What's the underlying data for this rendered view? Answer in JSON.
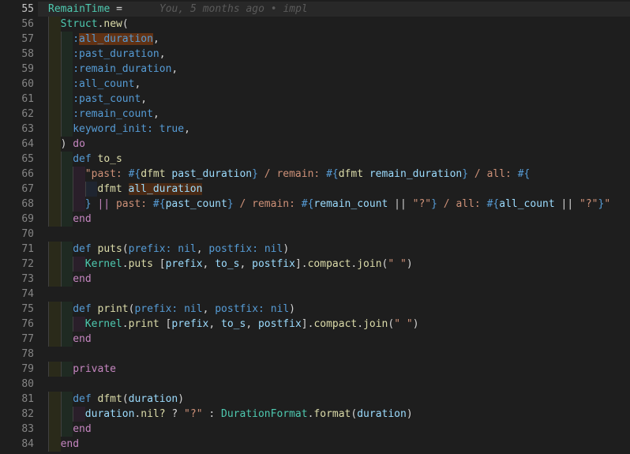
{
  "editor": {
    "blame": "You, 5 months ago • impl",
    "lines": [
      {
        "num": "55",
        "current": true,
        "tokens": [
          [
            "RemainTime",
            "const"
          ],
          [
            " = ",
            "punc"
          ]
        ]
      },
      {
        "num": "56",
        "tokens": [
          [
            "Struct",
            "const"
          ],
          [
            ".",
            "punc"
          ],
          [
            "new",
            "fn"
          ],
          [
            "(",
            "punc"
          ]
        ]
      },
      {
        "num": "57",
        "tokens": [
          [
            ":",
            "sym"
          ],
          [
            "all_duration",
            "sym",
            "hl"
          ],
          [
            ",",
            "punc"
          ]
        ]
      },
      {
        "num": "58",
        "tokens": [
          [
            ":past_duration",
            "sym"
          ],
          [
            ",",
            "punc"
          ]
        ]
      },
      {
        "num": "59",
        "tokens": [
          [
            ":remain_duration",
            "sym"
          ],
          [
            ",",
            "punc"
          ]
        ]
      },
      {
        "num": "60",
        "tokens": [
          [
            ":all_count",
            "sym"
          ],
          [
            ",",
            "punc"
          ]
        ]
      },
      {
        "num": "61",
        "tokens": [
          [
            ":past_count",
            "sym"
          ],
          [
            ",",
            "punc"
          ]
        ]
      },
      {
        "num": "62",
        "tokens": [
          [
            ":remain_count",
            "sym"
          ],
          [
            ",",
            "punc"
          ]
        ]
      },
      {
        "num": "63",
        "tokens": [
          [
            "keyword_init:",
            "sym"
          ],
          [
            " ",
            "punc"
          ],
          [
            "true",
            "bool"
          ],
          [
            ",",
            "punc"
          ]
        ]
      },
      {
        "num": "64",
        "tokens": [
          [
            ") ",
            "punc"
          ],
          [
            "do",
            "kw"
          ]
        ]
      },
      {
        "num": "65",
        "tokens": [
          [
            "def ",
            "def"
          ],
          [
            "to_s",
            "fn"
          ]
        ]
      },
      {
        "num": "66",
        "tokens": [
          [
            "\"past: ",
            "str"
          ],
          [
            "#{",
            "interp"
          ],
          [
            "dfmt",
            "fn"
          ],
          [
            " ",
            "punc"
          ],
          [
            "past_duration",
            "var"
          ],
          [
            "}",
            "interp"
          ],
          [
            " / remain: ",
            "str"
          ],
          [
            "#{",
            "interp"
          ],
          [
            "dfmt",
            "fn"
          ],
          [
            " ",
            "punc"
          ],
          [
            "remain_duration",
            "var"
          ],
          [
            "}",
            "interp"
          ],
          [
            " / all: ",
            "str"
          ],
          [
            "#{",
            "interp"
          ]
        ]
      },
      {
        "num": "67",
        "tokens": [
          [
            "dfmt",
            "fn"
          ],
          [
            " ",
            "punc"
          ],
          [
            "all_duration",
            "var",
            "hl2"
          ]
        ]
      },
      {
        "num": "68",
        "tokens": [
          [
            "}",
            "interp"
          ],
          [
            " || ",
            "kw"
          ],
          [
            "past: ",
            "str"
          ],
          [
            "#{",
            "interp"
          ],
          [
            "past_count",
            "var"
          ],
          [
            "}",
            "interp"
          ],
          [
            " / remain: ",
            "str"
          ],
          [
            "#{",
            "interp"
          ],
          [
            "remain_count",
            "var"
          ],
          [
            " || ",
            "punc"
          ],
          [
            "\"?\"",
            "str"
          ],
          [
            "}",
            "interp"
          ],
          [
            " / all: ",
            "str"
          ],
          [
            "#{",
            "interp"
          ],
          [
            "all_count",
            "var"
          ],
          [
            " || ",
            "punc"
          ],
          [
            "\"?\"",
            "str"
          ],
          [
            "}",
            "interp"
          ],
          [
            "\"",
            "str"
          ]
        ]
      },
      {
        "num": "69",
        "tokens": [
          [
            "end",
            "kw"
          ]
        ]
      },
      {
        "num": "70",
        "tokens": []
      },
      {
        "num": "71",
        "tokens": [
          [
            "def ",
            "def"
          ],
          [
            "puts",
            "fn"
          ],
          [
            "(",
            "punc"
          ],
          [
            "prefix:",
            "sym"
          ],
          [
            " ",
            "punc"
          ],
          [
            "nil",
            "bool"
          ],
          [
            ", ",
            "punc"
          ],
          [
            "postfix:",
            "sym"
          ],
          [
            " ",
            "punc"
          ],
          [
            "nil",
            "bool"
          ],
          [
            ")",
            "punc"
          ]
        ]
      },
      {
        "num": "72",
        "tokens": [
          [
            "Kernel",
            "const"
          ],
          [
            ".",
            "punc"
          ],
          [
            "puts",
            "fn"
          ],
          [
            " [",
            "punc"
          ],
          [
            "prefix",
            "var"
          ],
          [
            ", ",
            "punc"
          ],
          [
            "to_s",
            "var"
          ],
          [
            ", ",
            "punc"
          ],
          [
            "postfix",
            "var"
          ],
          [
            "].",
            "punc"
          ],
          [
            "compact",
            "fn"
          ],
          [
            ".",
            "punc"
          ],
          [
            "join",
            "fn"
          ],
          [
            "(",
            "punc"
          ],
          [
            "\" \"",
            "str"
          ],
          [
            ")",
            "punc"
          ]
        ]
      },
      {
        "num": "73",
        "tokens": [
          [
            "end",
            "kw"
          ]
        ]
      },
      {
        "num": "74",
        "tokens": []
      },
      {
        "num": "75",
        "tokens": [
          [
            "def ",
            "def"
          ],
          [
            "print",
            "fn"
          ],
          [
            "(",
            "punc"
          ],
          [
            "prefix:",
            "sym"
          ],
          [
            " ",
            "punc"
          ],
          [
            "nil",
            "bool"
          ],
          [
            ", ",
            "punc"
          ],
          [
            "postfix:",
            "sym"
          ],
          [
            " ",
            "punc"
          ],
          [
            "nil",
            "bool"
          ],
          [
            ")",
            "punc"
          ]
        ]
      },
      {
        "num": "76",
        "tokens": [
          [
            "Kernel",
            "const"
          ],
          [
            ".",
            "punc"
          ],
          [
            "print",
            "fn"
          ],
          [
            " [",
            "punc"
          ],
          [
            "prefix",
            "var"
          ],
          [
            ", ",
            "punc"
          ],
          [
            "to_s",
            "var"
          ],
          [
            ", ",
            "punc"
          ],
          [
            "postfix",
            "var"
          ],
          [
            "].",
            "punc"
          ],
          [
            "compact",
            "fn"
          ],
          [
            ".",
            "punc"
          ],
          [
            "join",
            "fn"
          ],
          [
            "(",
            "punc"
          ],
          [
            "\" \"",
            "str"
          ],
          [
            ")",
            "punc"
          ]
        ]
      },
      {
        "num": "77",
        "tokens": [
          [
            "end",
            "kw"
          ]
        ]
      },
      {
        "num": "78",
        "tokens": []
      },
      {
        "num": "79",
        "tokens": [
          [
            "private",
            "kw"
          ]
        ]
      },
      {
        "num": "80",
        "tokens": []
      },
      {
        "num": "81",
        "tokens": [
          [
            "def ",
            "def"
          ],
          [
            "dfmt",
            "fn"
          ],
          [
            "(",
            "punc"
          ],
          [
            "duration",
            "var"
          ],
          [
            ")",
            "punc"
          ]
        ]
      },
      {
        "num": "82",
        "tokens": [
          [
            "duration",
            "var"
          ],
          [
            ".",
            "punc"
          ],
          [
            "nil?",
            "fn"
          ],
          [
            " ? ",
            "punc"
          ],
          [
            "\"?\"",
            "str"
          ],
          [
            " : ",
            "punc"
          ],
          [
            "DurationFormat",
            "const"
          ],
          [
            ".",
            "punc"
          ],
          [
            "format",
            "fn"
          ],
          [
            "(",
            "punc"
          ],
          [
            "duration",
            "var"
          ],
          [
            ")",
            "punc"
          ]
        ]
      },
      {
        "num": "83",
        "tokens": [
          [
            "end",
            "kw"
          ]
        ]
      },
      {
        "num": "84",
        "tokens": [
          [
            "end",
            "kw"
          ]
        ]
      }
    ]
  }
}
